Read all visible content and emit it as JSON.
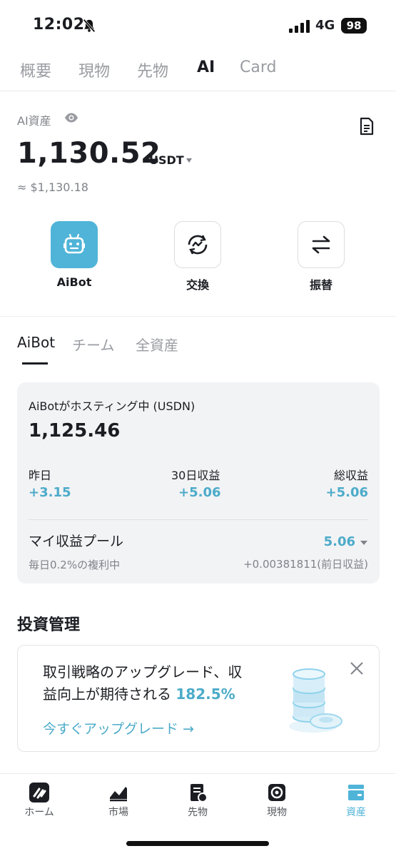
{
  "status_bar": {
    "time": "12:02",
    "network": "4G",
    "battery": "98"
  },
  "top_tabs": [
    {
      "label": "概要",
      "active": false
    },
    {
      "label": "現物",
      "active": false
    },
    {
      "label": "先物",
      "active": false
    },
    {
      "label": "AI",
      "active": true
    },
    {
      "label": "Card",
      "active": false
    }
  ],
  "asset": {
    "label": "AI資産",
    "amount": "1,130.52",
    "unit": "USDT",
    "approx": "≈ $1,130.18"
  },
  "actions": [
    {
      "label": "AiBot",
      "icon": "robot-icon"
    },
    {
      "label": "交換",
      "icon": "swap-icon"
    },
    {
      "label": "振替",
      "icon": "transfer-icon"
    }
  ],
  "sub_tabs": [
    {
      "label": "AiBot",
      "active": true
    },
    {
      "label": "チーム",
      "active": false
    },
    {
      "label": "全資産",
      "active": false
    }
  ],
  "hosting": {
    "title": "AiBotがホスティング中 (USDN)",
    "amount": "1,125.46",
    "stats": [
      {
        "label": "昨日",
        "value": "+3.15"
      },
      {
        "label": "30日収益",
        "value": "+5.06"
      },
      {
        "label": "総収益",
        "value": "+5.06"
      }
    ],
    "pool_label": "マイ収益プール",
    "pool_value": "5.06",
    "pool_sub": "毎日0.2%の複利中",
    "pool_yesterday": "+0.00381811(前日収益)"
  },
  "invest": {
    "title": "投資管理",
    "promo_text_1": "取引戦略のアップグレード、収",
    "promo_text_2": "益向上が期待される",
    "promo_rate": "182.5%",
    "promo_link": "今すぐアップグレード →"
  },
  "bottom_nav": [
    {
      "label": "ホーム",
      "icon": "home-logo-icon",
      "active": false
    },
    {
      "label": "市場",
      "icon": "market-chart-icon",
      "active": false
    },
    {
      "label": "先物",
      "icon": "futures-icon",
      "active": false
    },
    {
      "label": "現物",
      "icon": "spot-icon",
      "active": false
    },
    {
      "label": "資産",
      "icon": "wallet-icon",
      "active": true
    }
  ],
  "colors": {
    "accent": "#4fb4d8",
    "positive": "#4cabc9",
    "muted": "#80838a"
  }
}
